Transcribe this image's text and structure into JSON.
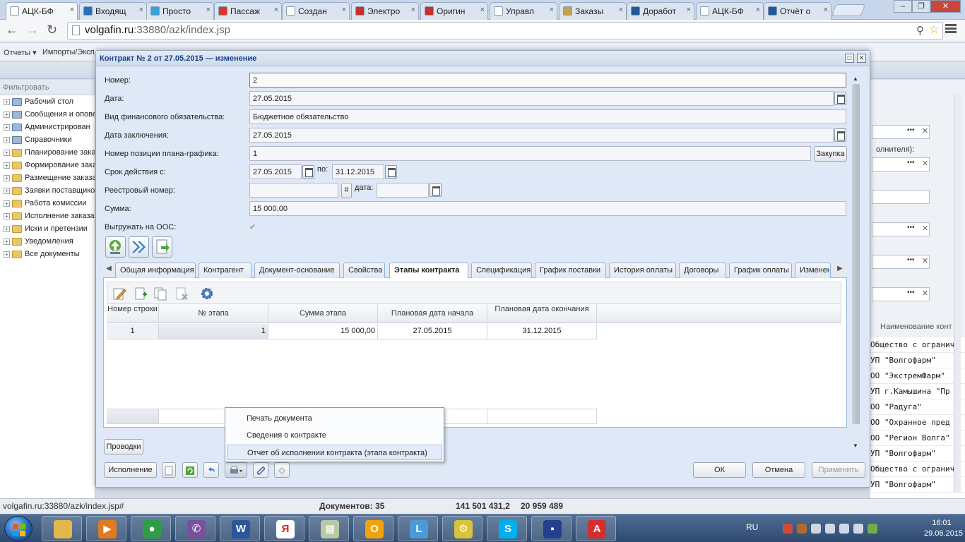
{
  "browser": {
    "tabs": [
      {
        "label": "АЦК-БФ",
        "color": "#ffffff",
        "active": true
      },
      {
        "label": "Входящ",
        "color": "#2a6fb6"
      },
      {
        "label": "Просто",
        "color": "#3aa0d8"
      },
      {
        "label": "Пассаж",
        "color": "#d9362b"
      },
      {
        "label": "Создан",
        "color": "#ffffff"
      },
      {
        "label": "Электро",
        "color": "#c9302c"
      },
      {
        "label": "Оригин",
        "color": "#c9302c"
      },
      {
        "label": "Управл",
        "color": "#ffffff"
      },
      {
        "label": "Заказы",
        "color": "#c7a14a"
      },
      {
        "label": "Доработ",
        "color": "#1f5a99"
      },
      {
        "label": "АЦК-БФ",
        "color": "#ffffff"
      },
      {
        "label": "Отчёт о",
        "color": "#1f5a99"
      }
    ],
    "tab_close": "×",
    "url_host": "volgafin.ru",
    "url_path": ":33880/azk/index.jsp",
    "window_min": "–",
    "window_max": "❐",
    "window_close": "✕"
  },
  "app": {
    "menu": [
      "Отчеты ▾",
      "Импорты/Эксп"
    ],
    "filter_label": "Фильтровать",
    "tree": [
      {
        "label": "Рабочий стол",
        "icon": "desktop-icon"
      },
      {
        "label": "Сообщения и опове",
        "icon": "messages-icon"
      },
      {
        "label": "Администрирован",
        "icon": "admin-icon"
      },
      {
        "label": "Справочники",
        "icon": "directory-icon"
      },
      {
        "label": "Планирование зака",
        "icon": "folder-icon"
      },
      {
        "label": "Формирование зака",
        "icon": "folder-icon"
      },
      {
        "label": "Размещение заказа",
        "icon": "folder-icon"
      },
      {
        "label": "Заявки поставщико",
        "icon": "folder-icon"
      },
      {
        "label": "Работа комиссии",
        "icon": "folder-icon"
      },
      {
        "label": "Исполнение заказа",
        "icon": "folder-icon"
      },
      {
        "label": "Иски и претензии",
        "icon": "folder-icon"
      },
      {
        "label": "Уведомления",
        "icon": "folder-icon"
      },
      {
        "label": "Все документы",
        "icon": "folder-icon"
      }
    ],
    "right_label_top": "олнителя):",
    "right_column_header": "Наименование конт",
    "right_rows": [
      "Общество с огранич",
      "УП \"Волгофарм\"",
      "ОО \"ЭкстремФарм\"",
      "УП г.Камышина \"Пр",
      "ОО \"Радуга\"",
      "ОО \"Охранное пред",
      "ОО \"Регион Волга\"",
      "УП \"Волгофарм\"",
      "Общество с огранич",
      "УП \"Волгофарм\""
    ],
    "status_url": "volgafin.ru:33880/azk/index.jsp#",
    "status_docs": "Документов: 35",
    "status_sum1": "141 501 431,2",
    "status_sum2": "20 959 489"
  },
  "dialog": {
    "title": "Контракт № 2 от 27.05.2015 — изменение",
    "fields": {
      "number_label": "Номер:",
      "number_value": "2",
      "date_label": "Дата:",
      "date_value": "27.05.2015",
      "obligation_label": "Вид финансового обязательства:",
      "obligation_value": "Бюджетное обязательство",
      "conclusion_label": "Дата заключения:",
      "conclusion_value": "27.05.2015",
      "plan_position_label": "Номер позиции плана-графика:",
      "plan_position_value": "1",
      "purchase_button": "Закупка",
      "validity_label": "Срок действия с:",
      "validity_from": "27.05.2015",
      "validity_to_label": "по:",
      "validity_to": "31.12.2015",
      "registry_label": "Реестровый номер:",
      "registry_value": "",
      "registry_hash": "#",
      "registry_date_label": "дата:",
      "registry_date_value": "",
      "sum_label": "Сумма:",
      "sum_value": "15 000,00",
      "upload_label": "Выгружать на ООС:",
      "upload_checked": "✔"
    },
    "tabs": [
      {
        "label": "Общая информация"
      },
      {
        "label": "Контрагент"
      },
      {
        "label": "Документ-основание"
      },
      {
        "label": "Свойства"
      },
      {
        "label": "Этапы контракта",
        "active": true
      },
      {
        "label": "Спецификация"
      },
      {
        "label": "График поставки"
      },
      {
        "label": "История оплаты"
      },
      {
        "label": "Договоры"
      },
      {
        "label": "График оплаты"
      },
      {
        "label": "Изменени"
      }
    ],
    "tab_scroll_left": "◀",
    "tab_scroll_right": "▶",
    "grid": {
      "columns": [
        "Номер строки",
        "№ этапа",
        "Сумма этапа",
        "Плановая дата начала",
        "Плановая дата окончания"
      ],
      "rows": [
        {
          "row_no": "1",
          "stage_no": "1",
          "amount": "15 000,00",
          "start": "27.05.2015",
          "end": "31.12.2015"
        }
      ]
    },
    "postings_button": "Проводки",
    "execution_button": "Исполнение",
    "ok_button": "ОК",
    "cancel_button": "Отмена",
    "apply_button": "Применить",
    "context_menu": [
      {
        "label": "Печать документа"
      },
      {
        "label": "Сведения о контракте"
      },
      {
        "label": "Отчет об исполнении контракта (этапа контракта)",
        "hover": true
      }
    ]
  },
  "taskbar": {
    "apps": [
      {
        "icon": "explorer-icon",
        "color": "#e3b84b",
        "glyph": ""
      },
      {
        "icon": "media-player-icon",
        "color": "#e07b22",
        "glyph": "▶"
      },
      {
        "icon": "chrome-icon",
        "color": "#2f9d45",
        "glyph": "●"
      },
      {
        "icon": "viber-icon",
        "color": "#7b519d",
        "glyph": "✆"
      },
      {
        "icon": "word-icon",
        "color": "#2b579a",
        "glyph": "W"
      },
      {
        "icon": "yandex-icon",
        "color": "#ffffff",
        "glyph": "Я"
      },
      {
        "icon": "chart-app-icon",
        "color": "#b9c9a5",
        "glyph": "▦"
      },
      {
        "icon": "outlook-icon",
        "color": "#f0a30a",
        "glyph": "O"
      },
      {
        "icon": "remote-app-icon",
        "color": "#4a9bd6",
        "glyph": "L"
      },
      {
        "icon": "tool-app-icon",
        "color": "#d8c33c",
        "glyph": "⚙"
      },
      {
        "icon": "skype-icon",
        "color": "#00aff0",
        "glyph": "S"
      },
      {
        "icon": "save-app-icon",
        "color": "#23408e",
        "glyph": "▪"
      },
      {
        "icon": "pdf-icon",
        "color": "#d32f2f",
        "glyph": "A"
      }
    ],
    "lang": "RU",
    "time": "16:01",
    "date": "29.06.2015"
  }
}
